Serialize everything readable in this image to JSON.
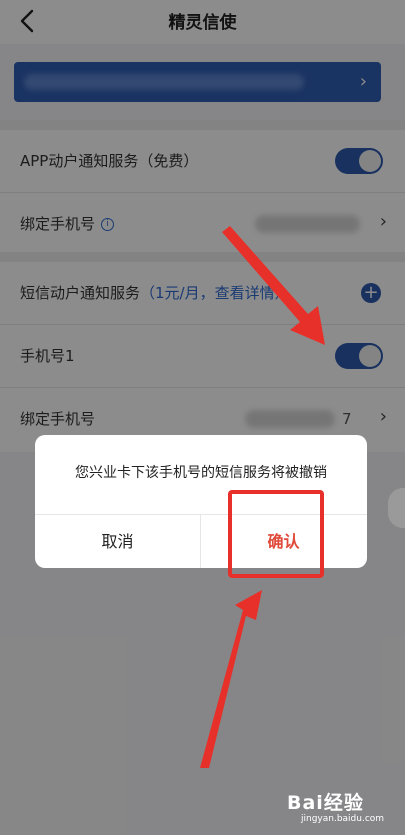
{
  "nav": {
    "title": "精灵信使"
  },
  "sections": {
    "app_notify": {
      "label": "APP动户通知服务（免费）",
      "toggle_on": true
    },
    "bind_phone_1": {
      "label": "绑定手机号"
    },
    "sms_notify": {
      "label": "短信动户通知服务",
      "price_hint": "（1元/月，查看详情）"
    },
    "phone1": {
      "label": "手机号1",
      "toggle_on": true
    },
    "bind_phone_2": {
      "label": "绑定手机号",
      "partial_number": "7"
    }
  },
  "dialog": {
    "message": "您兴业卡下该手机号的短信服务将被撤销",
    "cancel_label": "取消",
    "confirm_label": "确认"
  },
  "watermark": {
    "logo": "Bai经验",
    "sub": "jingyan.baidu.com"
  },
  "colors": {
    "accent": "#2d5aad",
    "confirm": "#e04a3a",
    "annotation": "#e8302a"
  }
}
